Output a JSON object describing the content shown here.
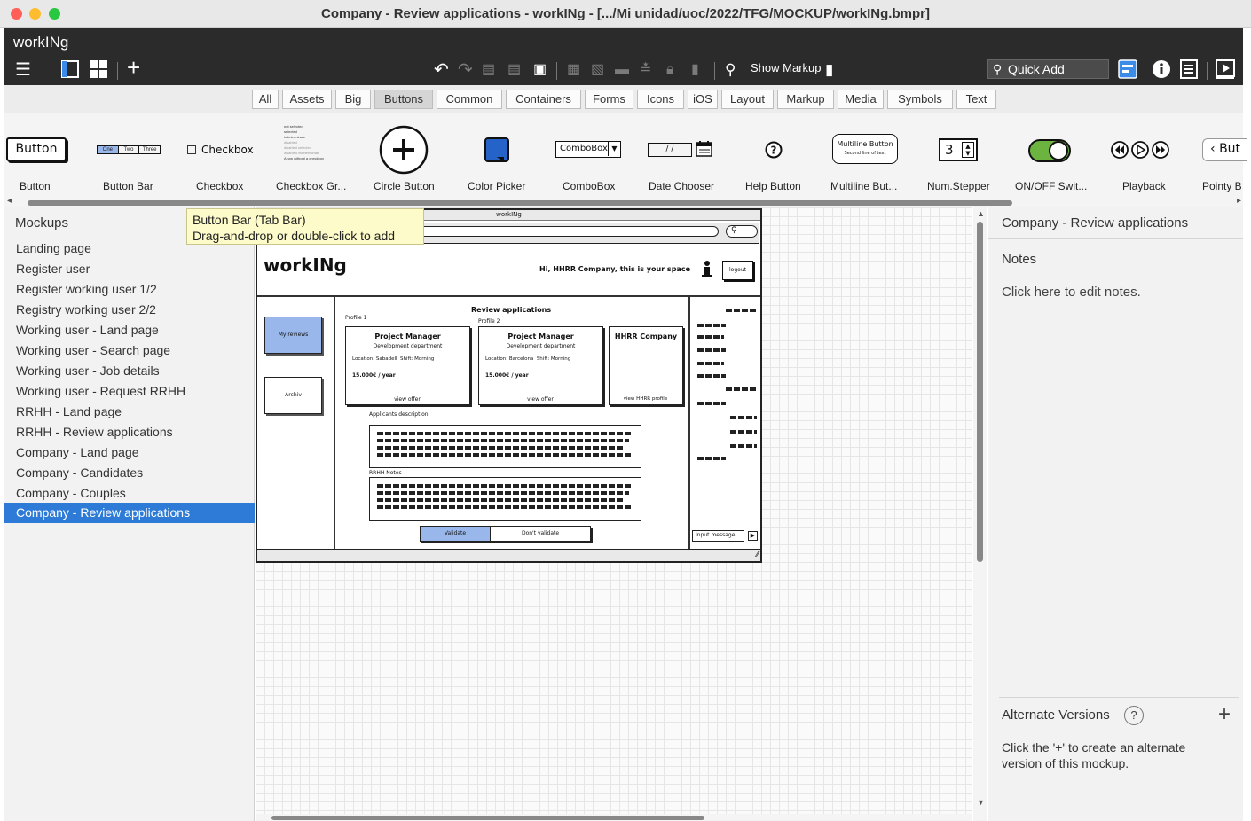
{
  "window": {
    "title": "Company - Review applications - workINg - [.../Mi unidad/uoc/2022/TFG/MOCKUP/workINg.bmpr]",
    "traffic_lights": {
      "close": "#ff5f57",
      "minimize": "#febc2e",
      "maximize": "#28c840"
    }
  },
  "app": {
    "name": "workINg",
    "show_markup": "Show Markup",
    "quick_add": "Quick Add"
  },
  "filter_tabs": [
    "All",
    "Assets",
    "Big",
    "Buttons",
    "Common",
    "Containers",
    "Forms",
    "Icons",
    "iOS",
    "Layout",
    "Markup",
    "Media",
    "Symbols",
    "Text"
  ],
  "filter_active": "Buttons",
  "library": {
    "items": [
      "Button",
      "Button Bar",
      "Checkbox",
      "Checkbox Gr...",
      "Circle Button",
      "Color Picker",
      "ComboBox",
      "Date Chooser",
      "Help Button",
      "Multiline But...",
      "Num.Stepper",
      "ON/OFF Swit...",
      "Playback",
      "Pointy B"
    ],
    "previews": {
      "button": "Button",
      "bar": [
        "One",
        "Two",
        "Three"
      ],
      "checkbox": "Checkbox",
      "checkgroup": [
        "not selected",
        "selected",
        "indeterminate",
        "disabled",
        "disabled selected",
        "disabled indeterminate",
        "A row without a checkbox"
      ],
      "combobox": "ComboBox",
      "date": "/ /",
      "multiline_1": "Multiline Button",
      "multiline_2": "Second line of text",
      "stepper": "3",
      "pointy": "But"
    }
  },
  "tooltip": {
    "line1": "Button Bar (Tab Bar)",
    "line2": "Drag-and-drop or double-click to add"
  },
  "left_panel": {
    "title": "Mockups",
    "items": [
      "Landing page",
      "Register user",
      "Register working user 1/2",
      "Registry working user 2/2",
      "Working user - Land page",
      "Working user - Search page",
      "Working user - Job details",
      "Working user - Request RRHH",
      "RRHH - Land page",
      "RRHH - Review applications",
      "Company - Land page",
      "Company - Candidates",
      "Company - Couples",
      "Company - Review applications"
    ],
    "selected_index": 13
  },
  "mockup": {
    "window_title": "workINg",
    "logo": "workINg",
    "greeting": "Hi, HHRR Company, this is your space",
    "logout": "logout",
    "nav": [
      "My reviews",
      "Archiv"
    ],
    "heading": "Review applications",
    "cards": [
      {
        "tag": "Profile 1",
        "title": "Project Manager",
        "dept": "Development department",
        "location": "Location: Sabadell",
        "shift": "Shift: Morning",
        "salary": "15.000€ / year",
        "action": "view offer"
      },
      {
        "tag": "Profile 2",
        "title": "Project Manager",
        "dept": "Development department",
        "location": "Location: Barcelona",
        "shift": "Shift: Morning",
        "salary": "15.000€ / year",
        "action": "view offer"
      }
    ],
    "company_card": {
      "title": "HHRR Company",
      "action": "view HHRR profile"
    },
    "applicants_label": "Applicants description",
    "notes_label": "RRHH Notes",
    "validate": "Validate",
    "dont_validate": "Don't validate",
    "input_message": "Input message"
  },
  "right_panel": {
    "title": "Company - Review applications",
    "notes_label": "Notes",
    "notes_hint": "Click here to edit notes.",
    "alt_title": "Alternate Versions",
    "alt_help": "?",
    "alt_add": "+",
    "alt_hint": "Click the '+' to create an alternate version of this mockup."
  },
  "colors": {
    "accent": "#2d7bd6",
    "nav_highlight": "#9ab7ec",
    "tooltip_bg": "#fdfbc9"
  }
}
